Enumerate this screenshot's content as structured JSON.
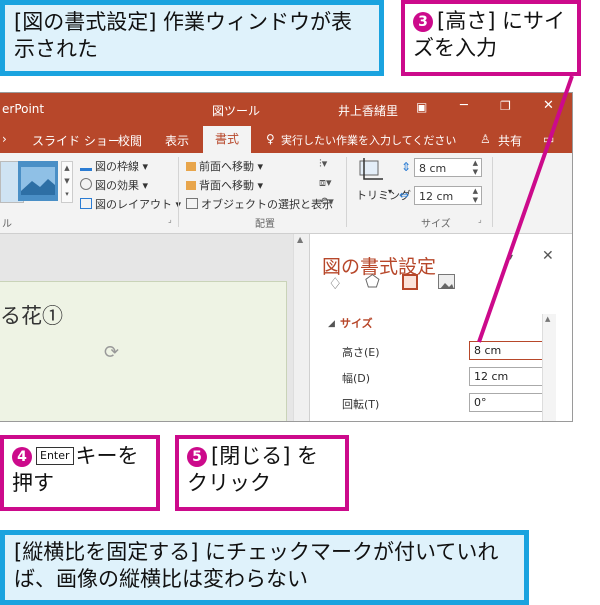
{
  "callouts": {
    "pane_shown": "[図の書式設定] 作業ウィンドウが表示された",
    "step3_number": "3",
    "step3_text": "[高さ] にサイズを入力",
    "step4_number": "4",
    "step4_key": "Enter",
    "step4_text": "キーを押す",
    "step5_number": "5",
    "step5_text": "[閉じる] をクリック",
    "note": "[縦横比を固定する] にチェックマークが付いていれば、画像の縦横比は変わらない"
  },
  "titlebar": {
    "app_title": "erPoint",
    "context_tool": "図ツール",
    "user_name": "井上香緒里"
  },
  "tabs": {
    "slideshow": "スライド ショー",
    "review": "校閲",
    "view": "表示",
    "format": "書式",
    "tell_me": "実行したい作業を入力してください",
    "share": "共有"
  },
  "ribbon": {
    "picture_border": "図の枠線",
    "picture_effects": "図の効果",
    "picture_layout": "図のレイアウト",
    "bring_forward": "前面へ移動",
    "send_backward": "背面へ移動",
    "selection_pane": "オブジェクトの選択と表示",
    "group_arrange": "配置",
    "crop": "トリミング",
    "height_value": "8 cm",
    "width_value": "12 cm",
    "group_size": "サイズ",
    "group_style_partial": "ル"
  },
  "slide": {
    "text": "る花①"
  },
  "pane": {
    "title": "図の書式設定",
    "section": "サイズ",
    "height_label": "高さ(E)",
    "height_value": "8 cm",
    "width_label": "幅(D)",
    "width_value": "12 cm",
    "rotation_label": "回転(T)",
    "rotation_value": "0°"
  }
}
